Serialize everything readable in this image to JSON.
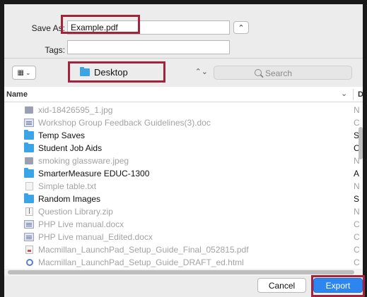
{
  "form": {
    "save_as_label": "Save As:",
    "save_as_value": "Example.pdf",
    "tags_label": "Tags:",
    "tags_value": ""
  },
  "toolbar": {
    "location_label": "Desktop",
    "search_placeholder": "Search"
  },
  "list": {
    "name_header": "Name",
    "second_col_header": "D",
    "items": [
      {
        "name": "xid-18426595_1.jpg",
        "kind": "N",
        "icon": "image-icon",
        "dim": true
      },
      {
        "name": "Workshop Group Feedback Guidelines(3).doc",
        "kind": "C",
        "icon": "doc-icon",
        "dim": true
      },
      {
        "name": "Temp Saves",
        "kind": "S",
        "icon": "folder-icon",
        "dim": false
      },
      {
        "name": "Student Job Aids",
        "kind": "C",
        "icon": "folder-icon",
        "dim": false
      },
      {
        "name": "smoking glassware.jpeg",
        "kind": "N",
        "icon": "image-icon",
        "dim": true
      },
      {
        "name": "SmarterMeasure EDUC-1300",
        "kind": "A",
        "icon": "folder-icon",
        "dim": false
      },
      {
        "name": "Simple table.txt",
        "kind": "N",
        "icon": "text-file-icon",
        "dim": true
      },
      {
        "name": "Random Images",
        "kind": "S",
        "icon": "folder-icon",
        "dim": false
      },
      {
        "name": "Question Library.zip",
        "kind": "N",
        "icon": "zip-icon",
        "dim": true
      },
      {
        "name": "PHP Live manual.docx",
        "kind": "C",
        "icon": "doc-icon",
        "dim": true
      },
      {
        "name": "PHP Live manual_Edited.docx",
        "kind": "C",
        "icon": "doc-icon",
        "dim": true
      },
      {
        "name": "Macmillan_LaunchPad_Setup_Guide_Final_052815.pdf",
        "kind": "C",
        "icon": "pdf-icon",
        "dim": true
      },
      {
        "name": "Macmillan_LaunchPad_Setup_Guide_DRAFT_ed.html",
        "kind": "C",
        "icon": "html-icon",
        "dim": true
      }
    ]
  },
  "footer": {
    "cancel_label": "Cancel",
    "export_label": "Export"
  },
  "colors": {
    "accent": "#2d86f0",
    "highlight": "#a3243a",
    "folder": "#3ba4e6"
  }
}
